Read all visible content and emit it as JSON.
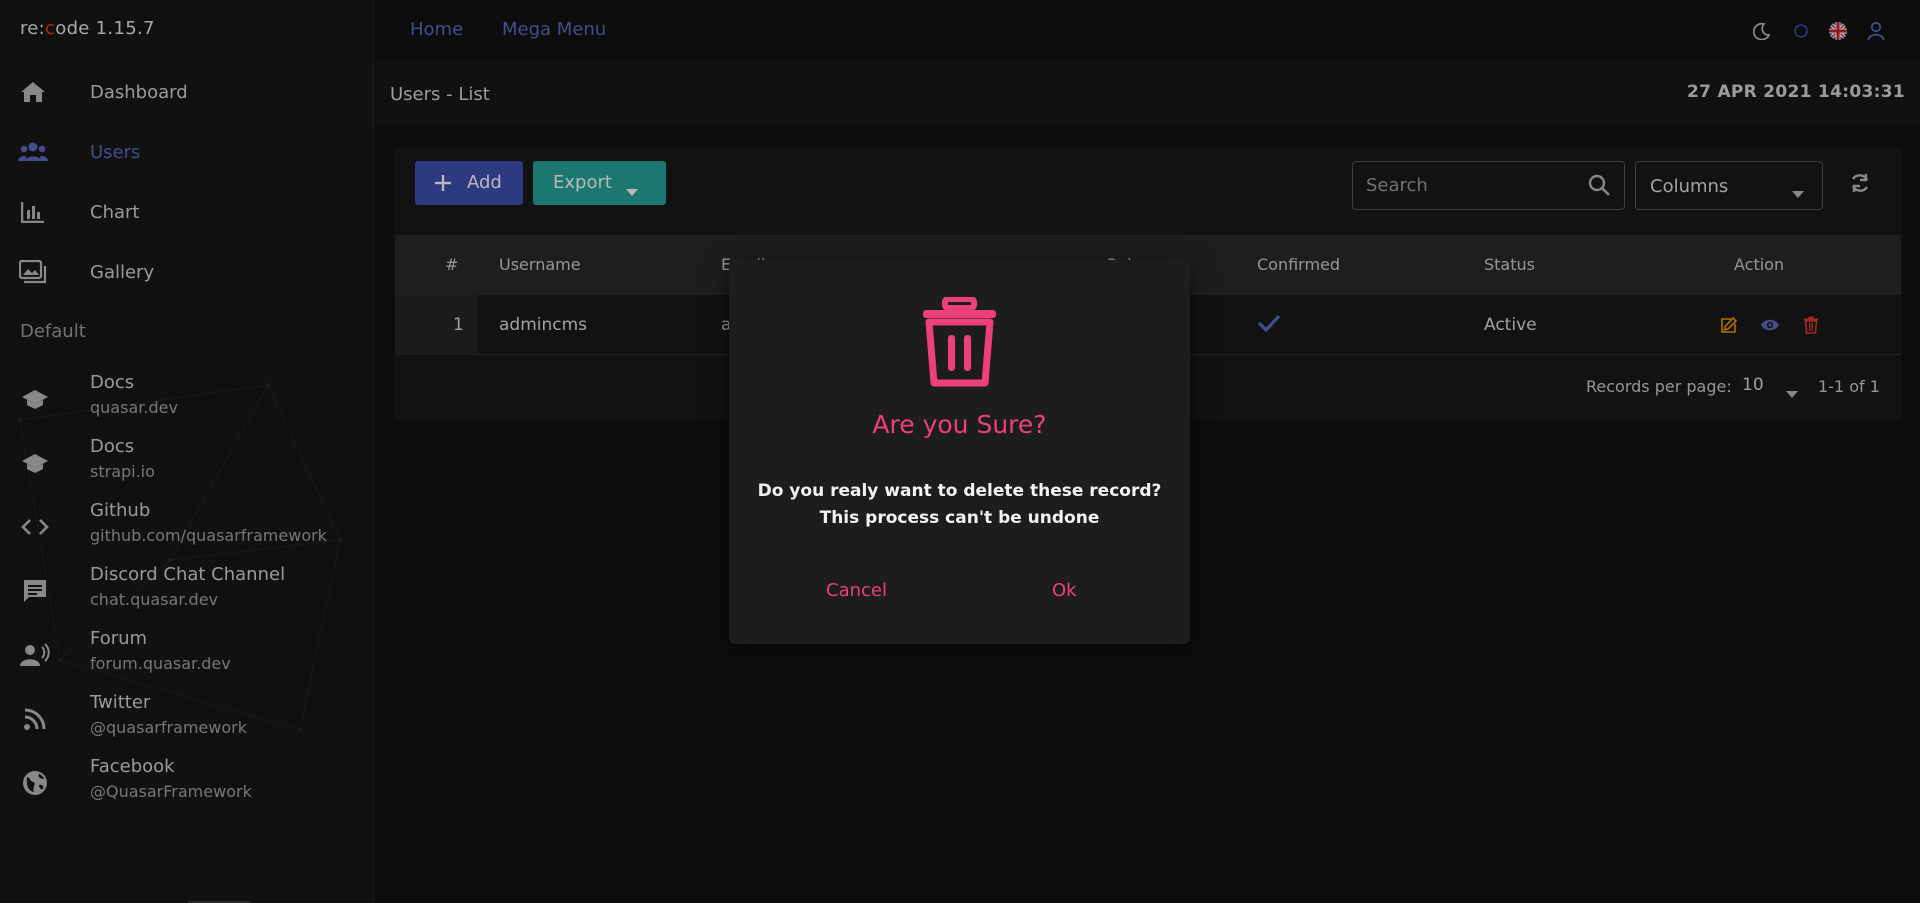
{
  "app": {
    "brand_prefix": "re:",
    "brand_c": "c",
    "brand_suffix": "ode 1.15.7"
  },
  "sidebar": {
    "nav": [
      {
        "label": "Dashboard",
        "icon": "home-icon"
      },
      {
        "label": "Users",
        "icon": "users-icon",
        "active": true
      },
      {
        "label": "Chart",
        "icon": "bar-chart-icon"
      },
      {
        "label": "Gallery",
        "icon": "gallery-icon"
      }
    ],
    "section_header": "Default",
    "links": [
      {
        "title": "Docs",
        "subtitle": "quasar.dev",
        "icon": "school-icon"
      },
      {
        "title": "Docs",
        "subtitle": "strapi.io",
        "icon": "school-icon"
      },
      {
        "title": "Github",
        "subtitle": "github.com/quasarframework",
        "icon": "code-icon"
      },
      {
        "title": "Discord Chat Channel",
        "subtitle": "chat.quasar.dev",
        "icon": "chat-icon"
      },
      {
        "title": "Forum",
        "subtitle": "forum.quasar.dev",
        "icon": "forum-icon"
      },
      {
        "title": "Twitter",
        "subtitle": "@quasarframework",
        "icon": "rss-icon"
      },
      {
        "title": "Facebook",
        "subtitle": "@QuasarFramework",
        "icon": "globe-icon"
      }
    ]
  },
  "topbar": {
    "links": [
      "Home",
      "Mega Menu"
    ],
    "icons": [
      "dark-mode-icon",
      "circle-icon",
      "uk-flag-icon",
      "user-icon"
    ]
  },
  "page": {
    "title": "Users - List",
    "datetime": "27 APR 2021 14:03:31"
  },
  "toolbar": {
    "add_label": "Add",
    "export_label": "Export",
    "search_placeholder": "Search",
    "columns_label": "Columns"
  },
  "table": {
    "headers": [
      "#",
      "Username",
      "Email",
      "Role",
      "Confirmed",
      "Status",
      "Action"
    ],
    "rows": [
      {
        "num": "1",
        "username": "admincms",
        "email_partial": "a",
        "confirmed": true,
        "status": "Active"
      }
    ]
  },
  "pager": {
    "label": "Records per page:",
    "per_page": "10",
    "range": "1-1 of 1"
  },
  "modal": {
    "title": "Are you Sure?",
    "line1": "Do you realy want to delete these record?",
    "line2": "This process can't be undone",
    "cancel": "Cancel",
    "ok": "Ok"
  },
  "colors": {
    "accent": "#5c6bc0",
    "add_button": "#3f51b5",
    "export_button": "#26a69a",
    "danger": "#ec407a",
    "edit_icon": "#ff9800"
  }
}
